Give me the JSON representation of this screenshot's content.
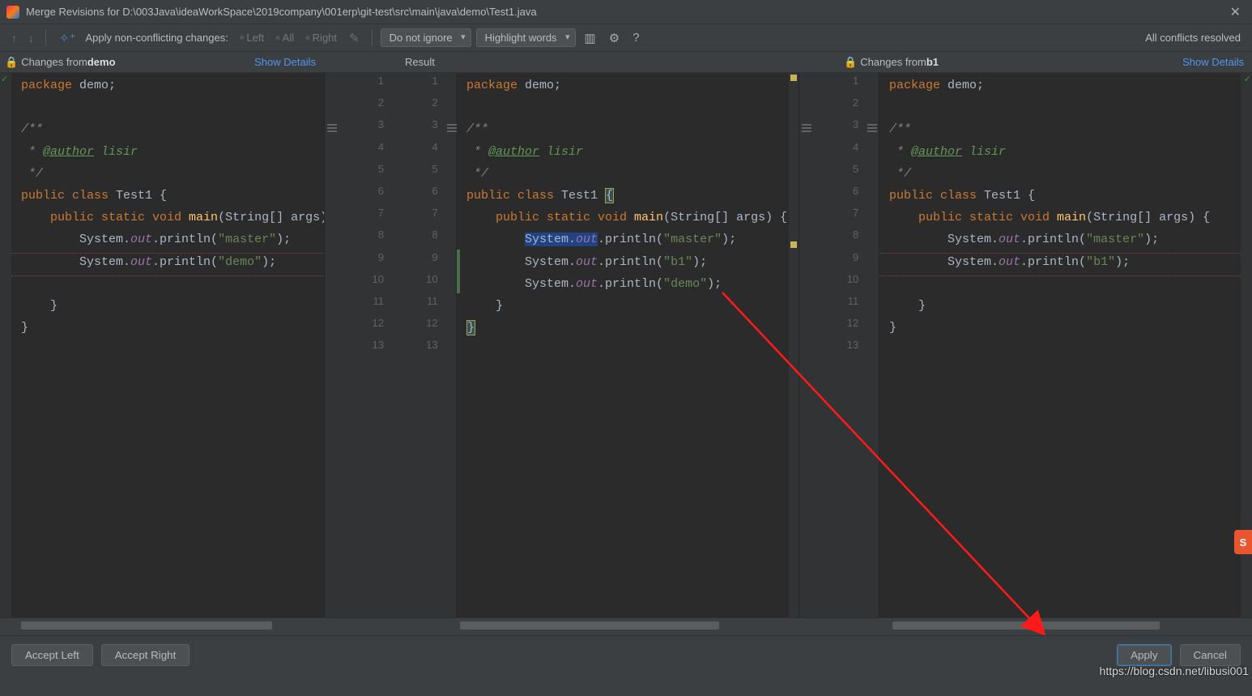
{
  "title": "Merge Revisions for D:\\003Java\\ideaWorkSpace\\2019company\\001erp\\git-test\\src\\main\\java\\demo\\Test1.java",
  "toolbar": {
    "apply_label": "Apply non-conflicting changes:",
    "left": "Left",
    "all": "All",
    "right": "Right",
    "ignore": "Do not ignore",
    "highlight": "Highlight words",
    "status": "All conflicts resolved"
  },
  "headers": {
    "left_prefix": "Changes from ",
    "left_branch": "demo",
    "result": "Result",
    "right_prefix": "Changes from ",
    "right_branch": "b1",
    "show_details": "Show Details"
  },
  "code": {
    "left": [
      {
        "t": "plain",
        "s": "package demo;",
        "hl": "pkg"
      },
      {
        "t": "blank"
      },
      {
        "t": "doc",
        "s": "/**"
      },
      {
        "t": "author"
      },
      {
        "t": "doc",
        "s": " */"
      },
      {
        "t": "classdecl"
      },
      {
        "t": "maindecl"
      },
      {
        "t": "println",
        "v": "master"
      },
      {
        "t": "println",
        "v": "demo"
      },
      {
        "t": "blank"
      },
      {
        "t": "closebrace",
        "indent": "    "
      },
      {
        "t": "closebrace",
        "indent": ""
      }
    ],
    "mid": [
      {
        "t": "plain",
        "s": "package demo;",
        "hl": "pkg"
      },
      {
        "t": "blank"
      },
      {
        "t": "doc",
        "s": "/**"
      },
      {
        "t": "author"
      },
      {
        "t": "doc",
        "s": " */"
      },
      {
        "t": "classdecl",
        "brace_hl": true
      },
      {
        "t": "maindecl"
      },
      {
        "t": "println",
        "v": "master",
        "emph": true
      },
      {
        "t": "println",
        "v": "b1"
      },
      {
        "t": "println",
        "v": "demo"
      },
      {
        "t": "closebrace",
        "indent": "    "
      },
      {
        "t": "closebrace",
        "indent": "",
        "brace_hl": true
      }
    ],
    "right": [
      {
        "t": "plain",
        "s": "package demo;",
        "hl": "pkg"
      },
      {
        "t": "blank"
      },
      {
        "t": "doc",
        "s": "/**"
      },
      {
        "t": "author"
      },
      {
        "t": "doc",
        "s": " */"
      },
      {
        "t": "classdecl"
      },
      {
        "t": "maindecl"
      },
      {
        "t": "println",
        "v": "master"
      },
      {
        "t": "println",
        "v": "b1"
      },
      {
        "t": "blank"
      },
      {
        "t": "closebrace",
        "indent": "    "
      },
      {
        "t": "closebrace",
        "indent": ""
      }
    ],
    "gutter_left": [
      "1",
      "2",
      "3",
      "4",
      "5",
      "6",
      "7",
      "8",
      "9",
      "10",
      "11",
      "12",
      "13"
    ],
    "gutter_mid": [
      "1",
      "2",
      "3",
      "4",
      "5",
      "6",
      "7",
      "8",
      "9",
      "10",
      "11",
      "12",
      "13"
    ],
    "gutter_right": [
      "1",
      "2",
      "3",
      "4",
      "5",
      "6",
      "7",
      "8",
      "9",
      "10",
      "11",
      "12",
      "13"
    ],
    "author_name": "lisir",
    "class_name": "Test1",
    "method": "main",
    "param": "String[] args"
  },
  "footer": {
    "accept_left": "Accept Left",
    "accept_right": "Accept Right",
    "apply": "Apply",
    "cancel": "Cancel"
  },
  "watermark": "https://blog.csdn.net/libusi001"
}
